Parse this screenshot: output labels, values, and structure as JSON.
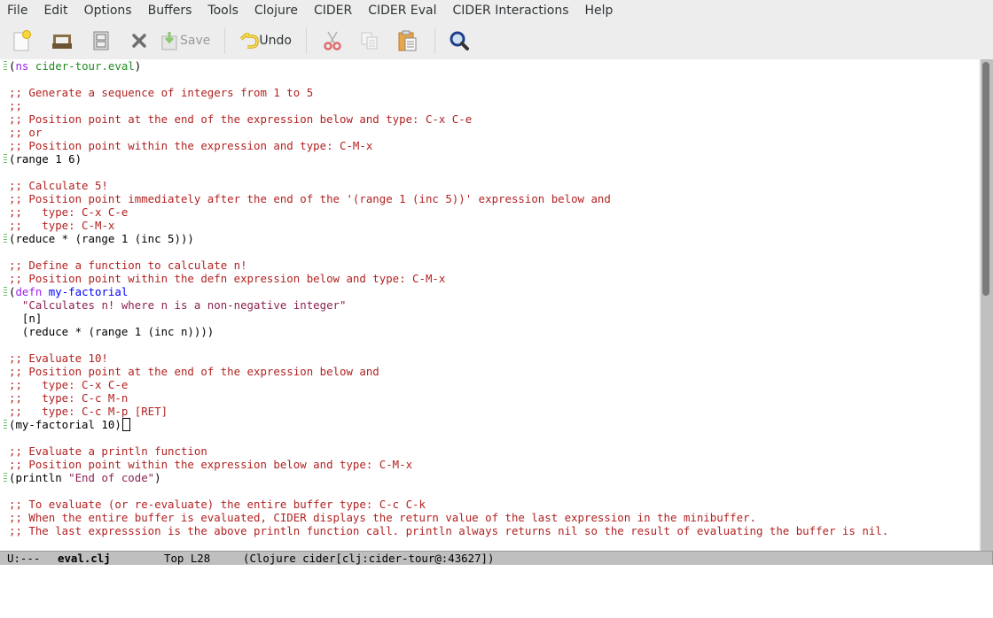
{
  "menubar": {
    "items": [
      "File",
      "Edit",
      "Options",
      "Buffers",
      "Tools",
      "Clojure",
      "CIDER",
      "CIDER Eval",
      "CIDER Interactions",
      "Help"
    ]
  },
  "toolbar": {
    "new_file_icon": "new-file-icon",
    "open_icon": "open-folder-icon",
    "dired_icon": "cabinet-icon",
    "close_icon": "close-icon",
    "save_label": "Save",
    "undo_label": "Undo",
    "cut_icon": "scissors-icon",
    "copy_icon": "copy-icon",
    "paste_icon": "paste-icon",
    "search_icon": "search-icon"
  },
  "buffer": {
    "lines": [
      {
        "segs": [
          {
            "t": "(",
            "c": ""
          },
          {
            "t": "ns",
            "c": "kw"
          },
          {
            "t": " ",
            "c": ""
          },
          {
            "t": "cider-tour.eval",
            "c": "ns"
          },
          {
            "t": ")",
            "c": ""
          }
        ],
        "fringe": true
      },
      {
        "segs": []
      },
      {
        "segs": [
          {
            "t": ";; Generate a sequence of integers from 1 to 5",
            "c": "cm"
          }
        ]
      },
      {
        "segs": [
          {
            "t": ";;",
            "c": "cm"
          }
        ]
      },
      {
        "segs": [
          {
            "t": ";; Position point at the end of the expression below and type: C-x C-e",
            "c": "cm"
          }
        ]
      },
      {
        "segs": [
          {
            "t": ";; or",
            "c": "cm"
          }
        ]
      },
      {
        "segs": [
          {
            "t": ";; Position point within the expression and type: C-M-x",
            "c": "cm"
          }
        ]
      },
      {
        "segs": [
          {
            "t": "(range 1 6)",
            "c": ""
          }
        ],
        "fringe": true
      },
      {
        "segs": []
      },
      {
        "segs": [
          {
            "t": ";; Calculate 5!",
            "c": "cm"
          }
        ]
      },
      {
        "segs": [
          {
            "t": ";; Position point immediately after the end of the '(range 1 (inc 5))' expression below and",
            "c": "cm"
          }
        ]
      },
      {
        "segs": [
          {
            "t": ";;   type: C-x C-e",
            "c": "cm"
          }
        ]
      },
      {
        "segs": [
          {
            "t": ";;   type: C-M-x",
            "c": "cm"
          }
        ]
      },
      {
        "segs": [
          {
            "t": "(reduce * (range 1 (inc 5)))",
            "c": ""
          }
        ],
        "fringe": true
      },
      {
        "segs": []
      },
      {
        "segs": [
          {
            "t": ";; Define a function to calculate n!",
            "c": "cm"
          }
        ]
      },
      {
        "segs": [
          {
            "t": ";; Position point within the defn expression below and type: C-M-x",
            "c": "cm"
          }
        ]
      },
      {
        "segs": [
          {
            "t": "(",
            "c": ""
          },
          {
            "t": "defn",
            "c": "kw"
          },
          {
            "t": " ",
            "c": ""
          },
          {
            "t": "my-factorial",
            "c": "fn"
          }
        ],
        "fringe": true
      },
      {
        "segs": [
          {
            "t": "  ",
            "c": ""
          },
          {
            "t": "\"Calculates n! where n is a non-negative integer\"",
            "c": "str"
          }
        ]
      },
      {
        "segs": [
          {
            "t": "  [n]",
            "c": ""
          }
        ]
      },
      {
        "segs": [
          {
            "t": "  (reduce * (range 1 (inc n))))",
            "c": ""
          }
        ]
      },
      {
        "segs": []
      },
      {
        "segs": [
          {
            "t": ";; Evaluate 10!",
            "c": "cm"
          }
        ]
      },
      {
        "segs": [
          {
            "t": ";; Position point at the end of the expression below and",
            "c": "cm"
          }
        ]
      },
      {
        "segs": [
          {
            "t": ";;   type: C-x C-e",
            "c": "cm"
          }
        ]
      },
      {
        "segs": [
          {
            "t": ";;   type: C-c M-n",
            "c": "cm"
          }
        ]
      },
      {
        "segs": [
          {
            "t": ";;   type: C-c M-p [RET]",
            "c": "cm"
          }
        ]
      },
      {
        "segs": [
          {
            "t": "(my-factorial 10)",
            "c": ""
          }
        ],
        "fringe": true,
        "cursor": true
      },
      {
        "segs": []
      },
      {
        "segs": [
          {
            "t": ";; Evaluate a println function",
            "c": "cm"
          }
        ]
      },
      {
        "segs": [
          {
            "t": ";; Position point within the expression below and type: C-M-x",
            "c": "cm"
          }
        ]
      },
      {
        "segs": [
          {
            "t": "(println ",
            "c": ""
          },
          {
            "t": "\"End of code\"",
            "c": "str"
          },
          {
            "t": ")",
            "c": ""
          }
        ],
        "fringe": true
      },
      {
        "segs": []
      },
      {
        "segs": [
          {
            "t": ";; To evaluate (or re-evaluate) the entire buffer type: C-c C-k",
            "c": "cm"
          }
        ]
      },
      {
        "segs": [
          {
            "t": ";; When the entire buffer is evaluated, CIDER displays the return value of the last expression in the minibuffer.",
            "c": "cm"
          }
        ]
      },
      {
        "segs": [
          {
            "t": ";; The last expresssion is the above println function call. println always returns nil so the result of evaluating the buffer is nil.",
            "c": "cm"
          }
        ]
      }
    ]
  },
  "modeline": {
    "status": "U:---",
    "buffer_name": "eval.clj",
    "position": "Top L28",
    "modes": "(Clojure cider[clj:cider-tour@:43627])"
  },
  "scrollbar": {
    "visible_fraction": 0.48,
    "position": "Top"
  }
}
